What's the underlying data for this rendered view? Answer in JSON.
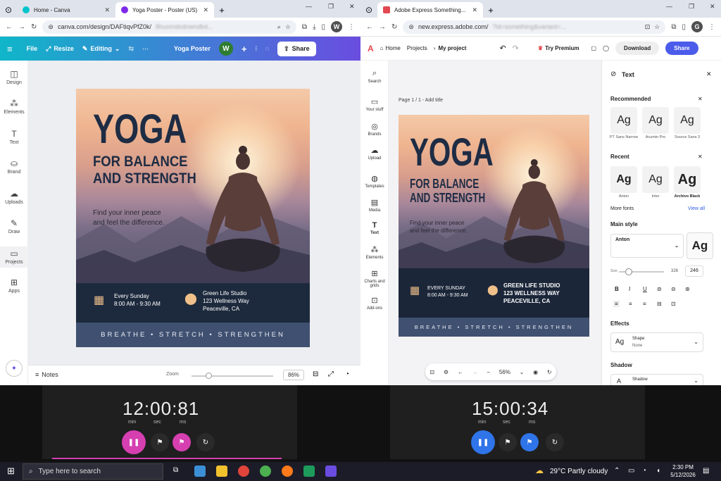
{
  "left_window": {
    "tabs": [
      {
        "title": "Home - Canva",
        "active": false
      },
      {
        "title": "Yoga Poster - Poster (US)",
        "active": true
      }
    ],
    "url": "canva.com/design/DAFtiqvPfZ0k/",
    "url_blur": "8hunmdodnwndbd...",
    "profile_letter": "W",
    "toolbar": {
      "file": "File",
      "resize": "Resize",
      "editing": "Editing",
      "doc_title": "Yoga Poster",
      "avatar": "W",
      "share": "Share"
    },
    "sidebar": [
      {
        "label": "Design",
        "icon": "design-icon"
      },
      {
        "label": "Elements",
        "icon": "elements-icon"
      },
      {
        "label": "Text",
        "icon": "text-icon"
      },
      {
        "label": "Brand",
        "icon": "brand-icon"
      },
      {
        "label": "Uploads",
        "icon": "uploads-icon"
      },
      {
        "label": "Draw",
        "icon": "draw-icon"
      },
      {
        "label": "Projects",
        "icon": "projects-icon"
      },
      {
        "label": "Apps",
        "icon": "apps-icon"
      }
    ],
    "bottom": {
      "notes": "Notes",
      "zoom_label": "Zoom",
      "zoom_value": "86%"
    }
  },
  "right_window": {
    "tabs": [
      {
        "title": "Adobe Express Something...",
        "active": true
      }
    ],
    "url": "new.express.adobe.com/",
    "url_blur": "?id=something&variant=...",
    "profile_letter": "G",
    "toolbar": {
      "home": "Home",
      "projects": "Projects",
      "my_project": "My project",
      "try_premium": "Try Premium",
      "download": "Download",
      "share": "Share"
    },
    "sidebar": [
      {
        "label": "Search"
      },
      {
        "label": "Your stuff"
      },
      {
        "label": "Brands"
      },
      {
        "label": "Upload"
      },
      {
        "label": "Templates"
      },
      {
        "label": "Media"
      },
      {
        "label": "Text"
      },
      {
        "label": "Elements"
      },
      {
        "label": "Charts and grids"
      },
      {
        "label": "Add-ons"
      }
    ],
    "page_label": "Page 1 / 1 - Add title",
    "zoom": "56%",
    "panel": {
      "title": "Text",
      "recommended": "Recommended",
      "recommended_fonts": [
        {
          "name": "PT Sans Narrow"
        },
        {
          "name": "Acumin Pro"
        },
        {
          "name": "Source Sans 3"
        }
      ],
      "recent": "Recent",
      "recent_fonts": [
        {
          "name": "Anton"
        },
        {
          "name": "Inter"
        },
        {
          "name": "Archivo Black"
        }
      ],
      "more_fonts": "More fonts",
      "view_all": "View all",
      "main_style": "Main style",
      "font_selected": "Anton",
      "size_label": "Size",
      "size_value": "246",
      "size_value2": "326",
      "effects": "Effects",
      "shape_label": "Shape",
      "shape_value": "None",
      "shadow": "Shadow",
      "shadow_label": "Shadow"
    }
  },
  "poster": {
    "title": "YOGA",
    "subtitle_line1": "FOR BALANCE",
    "subtitle_line2": "AND STRENGTH",
    "tagline_line1": "Find your inner peace",
    "tagline_line2": "and feel the difference.",
    "schedule_line1": "Every Sunday",
    "schedule_line2": "8:00 AM - 9:30 AM",
    "studio_line1": "Green Life Studio",
    "studio_line2": "123 Wellness Way",
    "studio_line3": "Peaceville, CA",
    "band": "BREATHE • STRETCH • STRENGTHEN"
  },
  "poster_adobe": {
    "schedule_line1": "EVERY SUNDAY",
    "schedule_line2": "8:00 AM - 9:30 AM",
    "studio_line1": "GREEN LIFE STUDIO",
    "studio_line2": "123 WELLNESS WAY",
    "studio_line3": "PEACEVILLE, CA"
  },
  "timers": [
    {
      "min": "12",
      "sec": "00",
      "ms": "81",
      "accent": "#d63fb0",
      "label_min": "min",
      "label_sec": "sec",
      "label_ms": "ms"
    },
    {
      "min": "15",
      "sec": "00",
      "ms": "34",
      "accent": "#2f74e8",
      "label_min": "min",
      "label_sec": "sec",
      "label_ms": "ms"
    }
  ],
  "taskbar": {
    "search_placeholder": "Type here to search",
    "weather": "29°C  Partly cloudy",
    "time": "2:30 PM",
    "date": "5/12/2026"
  }
}
